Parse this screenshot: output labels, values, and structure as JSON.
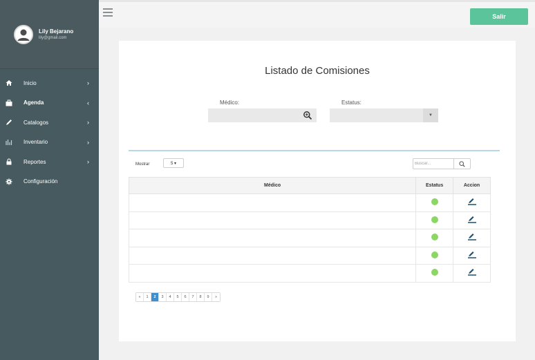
{
  "user": {
    "name": "Lily Bejarano",
    "email": "lily@gmail.com"
  },
  "sidebar": {
    "items": [
      {
        "label": "Inicio",
        "icon": "home-icon",
        "chevron": "›",
        "bold": false
      },
      {
        "label": "Agenda",
        "icon": "briefcase-icon",
        "chevron": "‹",
        "bold": true
      },
      {
        "label": "Catalogos",
        "icon": "pencil-icon",
        "chevron": "›",
        "bold": false
      },
      {
        "label": "Inventario",
        "icon": "chart-icon",
        "chevron": "›",
        "bold": false
      },
      {
        "label": "Reportes",
        "icon": "lock-icon",
        "chevron": "›",
        "bold": false
      },
      {
        "label": "Configuración",
        "icon": "gear-icon",
        "chevron": "",
        "bold": false
      }
    ]
  },
  "header": {
    "salir_label": "Salir"
  },
  "main": {
    "title": "Listado de Comisiones",
    "filters": {
      "medico_label": "Médico:",
      "estatus_label": "Estatus:",
      "medico_value": "",
      "estatus_value": ""
    },
    "table_controls": {
      "mostrar_label": "Mostrar",
      "page_size": "5 ▾",
      "search_placeholder": "Buscar..."
    },
    "table": {
      "columns": [
        "Médico",
        "Estatus",
        "Accion"
      ],
      "rows": [
        {
          "medico": "",
          "status_color": "#8cd665"
        },
        {
          "medico": "",
          "status_color": "#8cd665"
        },
        {
          "medico": "",
          "status_color": "#8cd665"
        },
        {
          "medico": "",
          "status_color": "#8cd665"
        },
        {
          "medico": "",
          "status_color": "#8cd665"
        }
      ]
    },
    "pagination": {
      "prev": "«",
      "pages": [
        "1",
        "2",
        "3",
        "4",
        "5",
        "6",
        "7",
        "8",
        "9"
      ],
      "next": "»",
      "current": "2"
    }
  },
  "colors": {
    "sidebar": "#475a5f",
    "accent_button": "#5cc49a",
    "active_page": "#3d8fd0",
    "status_ok": "#8cd665",
    "edit_icon": "#1c4e6e"
  }
}
